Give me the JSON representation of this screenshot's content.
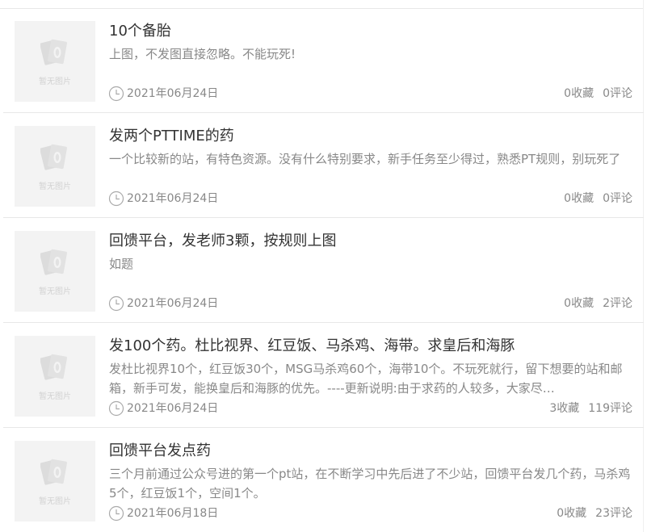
{
  "no_image_label": "暂无图片",
  "posts": [
    {
      "title": "10个备胎",
      "excerpt": "上图，不发图直接忽略。不能玩死!",
      "date": "2021年06月24日",
      "favorites": "0收藏",
      "comments": "0评论"
    },
    {
      "title": "发两个PTTIME的药",
      "excerpt": "一个比较新的站，有特色资源。没有什么特别要求，新手任务至少得过，熟悉PT规则，别玩死了",
      "date": "2021年06月24日",
      "favorites": "0收藏",
      "comments": "0评论"
    },
    {
      "title": "回馈平台，发老师3颗，按规则上图",
      "excerpt": "如题",
      "date": "2021年06月24日",
      "favorites": "0收藏",
      "comments": "2评论"
    },
    {
      "title": "发100个药。杜比视界、红豆饭、马杀鸡、海带。求皇后和海豚",
      "excerpt": "发杜比视界10个，红豆饭30个，MSG马杀鸡60个，海带10个。不玩死就行，留下想要的站和邮箱，新手可发，能换皇后和海豚的优先。----更新说明:由于求药的人较多，大家尽…",
      "date": "2021年06月24日",
      "favorites": "3收藏",
      "comments": "119评论"
    },
    {
      "title": "回馈平台发点药",
      "excerpt": "三个月前通过公众号进的第一个pt站，在不断学习中先后进了不少站，回馈平台发几个药，马杀鸡5个，红豆饭1个，空间1个。",
      "date": "2021年06月18日",
      "favorites": "0收藏",
      "comments": "23评论"
    }
  ]
}
